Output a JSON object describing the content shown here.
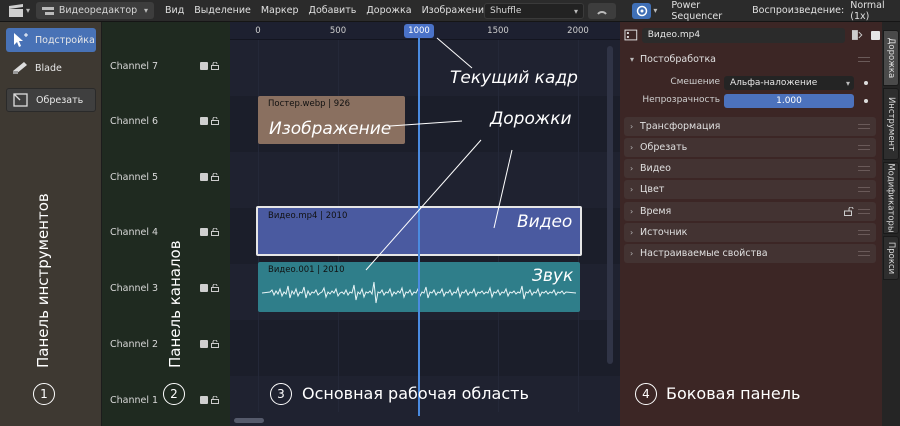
{
  "header": {
    "editor_type": "Видеоредактор",
    "menus": [
      "Вид",
      "Выделение",
      "Маркер",
      "Добавить",
      "Дорожка",
      "Изображение"
    ],
    "shuffle": "Shuffle",
    "addon": "Power Sequencer",
    "playback_label": "Воспроизведение:",
    "playback_mode": "Normal (1x)"
  },
  "tools": {
    "tweak": "Подстройка",
    "blade": "Blade",
    "trim": "Обрезать"
  },
  "channels": [
    "Channel 7",
    "Channel 6",
    "Channel 5",
    "Channel 4",
    "Channel 3",
    "Channel 2",
    "Channel 1"
  ],
  "timeline": {
    "ruler": [
      "0",
      "500",
      "1000",
      "1500",
      "2000"
    ],
    "current_frame": "1000",
    "strips": {
      "image": "Постер.webp | 926",
      "video": "Видео.mp4 | 2010",
      "audio": "Видео.001 | 2010"
    }
  },
  "sidebar": {
    "strip_name": "Видео.mp4",
    "post_processing": "Постобработка",
    "blend_label": "Смешение",
    "blend_value": "Альфа-наложение",
    "opacity_label": "Непрозрачность",
    "opacity_value": "1.000",
    "sections": [
      "Трансформация",
      "Обрезать",
      "Видео",
      "Цвет",
      "Время",
      "Источник",
      "Настраиваемые свойства"
    ],
    "tabs": [
      "Дорожка",
      "Инструмент",
      "Модификаторы",
      "Прокси"
    ]
  },
  "annotations": {
    "current_frame": "Текущий кадр",
    "image": "Изображение",
    "tracks": "Дорожки",
    "video": "Видео",
    "sound": "Звук",
    "tool_panel": "Панель инструментов",
    "channel_panel": "Панель каналов",
    "main_area": "Основная рабочая область",
    "side_panel": "Боковая панель",
    "n1": "1",
    "n2": "2",
    "n3": "3",
    "n4": "4"
  },
  "colors": {
    "active_tool": "#4872b6",
    "image_strip": "#8a7060",
    "video_strip": "#4a5aa0",
    "audio_strip": "#2f7e8a",
    "playhead": "#4a8be0",
    "side_panel_bg": "#3c2625"
  }
}
